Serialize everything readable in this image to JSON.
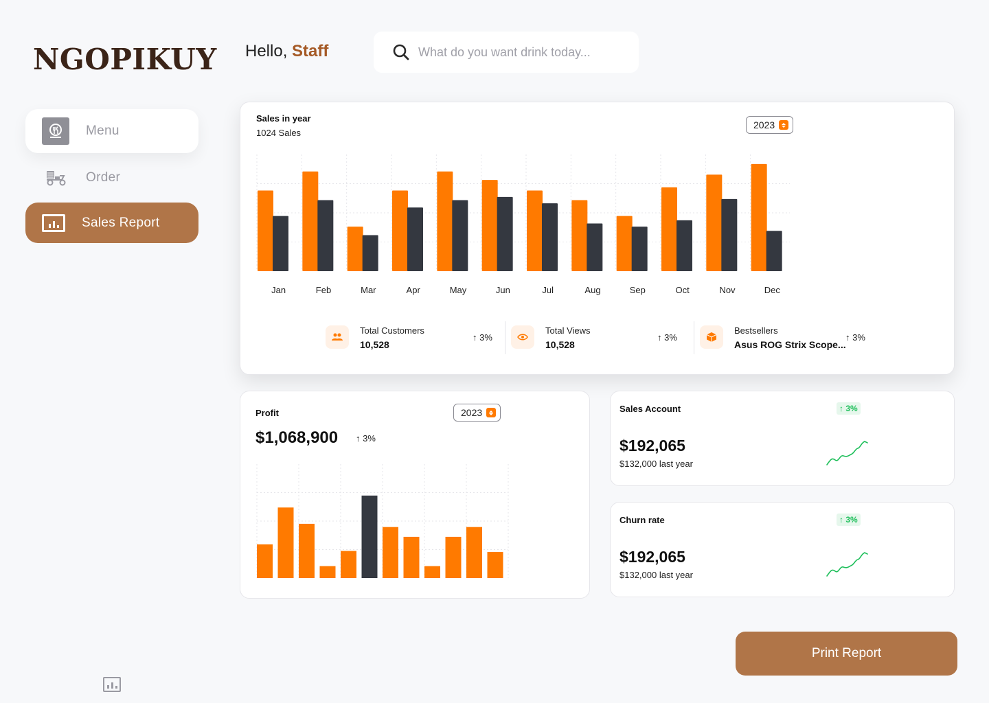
{
  "brand": {
    "logo": "NGOPIKUY"
  },
  "sidebar": {
    "items": [
      {
        "label": "Menu",
        "icon": "food-cloche-icon",
        "active": false
      },
      {
        "label": "Order",
        "icon": "delivery-scooter-icon",
        "active": false
      },
      {
        "label": "Sales Report",
        "icon": "bar-chart-icon",
        "active": true
      }
    ],
    "bottom_icon": "bar-chart-icon"
  },
  "header": {
    "greeting": "Hello,",
    "user": "Staff",
    "search_placeholder": "What do you want drink today..."
  },
  "sales": {
    "title": "Sales in year",
    "subtitle": "1024 Sales",
    "year": "2023",
    "stats": [
      {
        "label": "Total Customers",
        "value": "10,528",
        "change": "3%",
        "icon": "users-icon"
      },
      {
        "label": "Total Views",
        "value": "10,528",
        "change": "3%",
        "icon": "eye-icon"
      },
      {
        "label": "Bestsellers",
        "value": "Asus ROG Strix Scope...",
        "change": "3%",
        "icon": "box-icon"
      }
    ]
  },
  "profit": {
    "title": "Profit",
    "year": "2023",
    "value": "$1,068,900",
    "change": "3%"
  },
  "sales_account": {
    "title": "Sales Account",
    "badge": "3%",
    "value": "$192,065",
    "last_year": "$132,000 last year"
  },
  "churn_rate": {
    "title": "Churn rate",
    "badge": "3%",
    "value": "$192,065",
    "last_year": "$132,000 last year"
  },
  "actions": {
    "print": "Print Report"
  },
  "colors": {
    "accent": "#ff7a00",
    "dark_bar": "#343840",
    "brand_brown": "#b07548",
    "positive": "#1fbf5b"
  },
  "chart_data": [
    {
      "type": "bar",
      "categories": [
        "Jan",
        "Feb",
        "Mar",
        "Apr",
        "May",
        "Jun",
        "Jul",
        "Aug",
        "Sep",
        "Oct",
        "Nov",
        "Dec"
      ],
      "series": [
        {
          "values": [
            76,
            94,
            42,
            76,
            94,
            86,
            76,
            67,
            52,
            79,
            91,
            101
          ]
        },
        {
          "values": [
            52,
            67,
            34,
            60,
            67,
            70,
            64,
            45,
            42,
            48,
            68,
            38
          ]
        }
      ],
      "ylim": [
        0,
        110
      ],
      "grid": true,
      "legend": false
    },
    {
      "type": "bar",
      "values": [
        31,
        65,
        50,
        11,
        25,
        76,
        47,
        38,
        11,
        38,
        47,
        24
      ],
      "highlight_index": 5,
      "ylim": [
        0,
        105
      ],
      "grid": true,
      "legend": false
    }
  ]
}
